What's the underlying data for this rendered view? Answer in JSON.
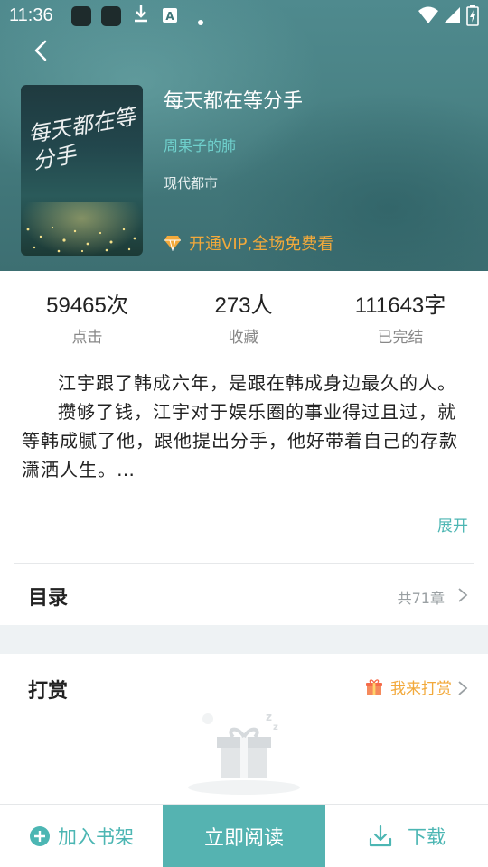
{
  "status_bar": {
    "time": "11:36",
    "icons": [
      "app-icon",
      "app-icon",
      "download-icon",
      "translate-icon",
      "dot-icon",
      "wifi-icon",
      "signal-icon",
      "battery-icon"
    ]
  },
  "book": {
    "title": "每天都在等分手",
    "author": "周果子的肺",
    "category": "现代都市",
    "cover_text": "每天都在等分手",
    "vip_text": "开通VIP,全场免费看"
  },
  "stats": [
    {
      "value": "59465次",
      "label": "点击"
    },
    {
      "value": "273人",
      "label": "收藏"
    },
    {
      "value": "111643字",
      "label": "已完结"
    }
  ],
  "synopsis": {
    "paragraphs": [
      "江宇跟了韩成六年，是跟在韩成身边最久的人。",
      "攒够了钱，江宇对于娱乐圈的事业得过且过，就等韩成腻了他，跟他提出分手，他好带着自己的存款潇洒人生。…"
    ],
    "expand_label": "展开"
  },
  "toc": {
    "title": "目录",
    "count": "共71章"
  },
  "tip": {
    "title": "打赏",
    "action": "我来打赏"
  },
  "bottom_bar": {
    "add_shelf": "加入书架",
    "read_now": "立即阅读",
    "download": "下载"
  },
  "colors": {
    "accent": "#55b3b1",
    "accent_text": "#4cb6b3",
    "vip": "#f2a93b",
    "header_bg": "#4a8386"
  }
}
